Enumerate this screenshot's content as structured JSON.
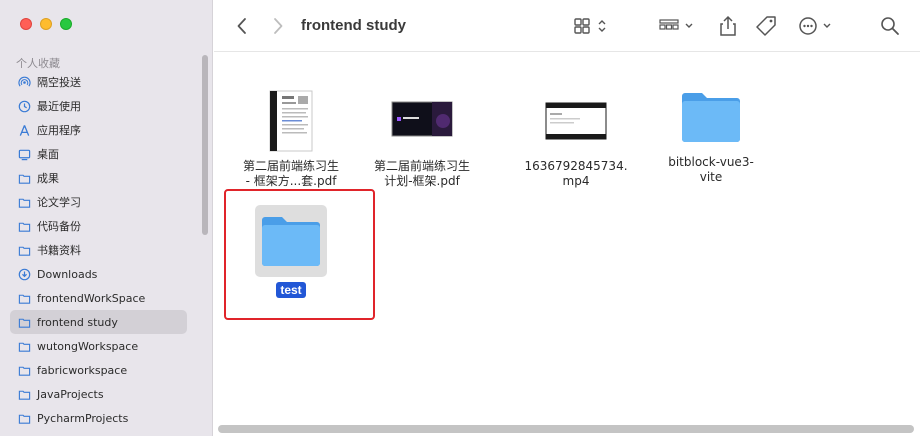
{
  "window": {
    "title": "frontend study"
  },
  "sidebar": {
    "section_title": "个人收藏",
    "items": [
      {
        "label": "隔空投送",
        "icon": "airdrop-icon"
      },
      {
        "label": "最近使用",
        "icon": "clock-icon"
      },
      {
        "label": "应用程序",
        "icon": "applications-icon"
      },
      {
        "label": "桌面",
        "icon": "desktop-icon"
      },
      {
        "label": "成果",
        "icon": "folder-icon"
      },
      {
        "label": "论文学习",
        "icon": "folder-icon"
      },
      {
        "label": "代码备份",
        "icon": "folder-icon"
      },
      {
        "label": "书籍资料",
        "icon": "folder-icon"
      },
      {
        "label": "Downloads",
        "icon": "download-icon"
      },
      {
        "label": "frontendWorkSpace",
        "icon": "folder-icon"
      },
      {
        "label": "frontend study",
        "icon": "folder-icon",
        "active": true
      },
      {
        "label": "wutongWorkspace",
        "icon": "folder-icon"
      },
      {
        "label": "fabricworkspace",
        "icon": "folder-icon"
      },
      {
        "label": "JavaProjects",
        "icon": "folder-icon"
      },
      {
        "label": "PycharmProjects",
        "icon": "folder-icon"
      }
    ]
  },
  "files": [
    {
      "name_line1": "第二届前端练习生",
      "name_line2": "- 框架方...套.pdf",
      "kind": "pdf-document"
    },
    {
      "name_line1": "第二届前端练习生",
      "name_line2": "计划-框架.pdf",
      "kind": "pdf-dark"
    },
    {
      "name_line1": "1636792845734.",
      "name_line2": "mp4",
      "kind": "video"
    },
    {
      "name_line1": "bitblock-vue3-",
      "name_line2": "vite",
      "kind": "folder"
    },
    {
      "name_line1": "test",
      "name_line2": "",
      "kind": "folder",
      "selected": true
    }
  ],
  "colors": {
    "accent": "#2257d6",
    "highlight": "#e0242a",
    "folder": "#5fb3f5"
  }
}
